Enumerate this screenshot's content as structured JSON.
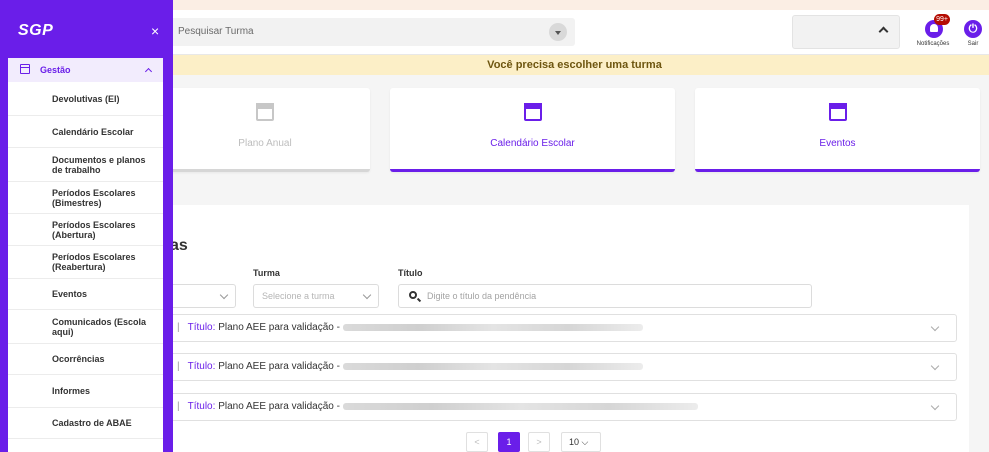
{
  "brand": "SGP",
  "header": {
    "search_placeholder": "Pesquisar Turma",
    "notifications_badge": "99+",
    "notifications_label": "Notificações",
    "logout_label": "Sair"
  },
  "alert": "Você precisa escolher uma turma",
  "cards": [
    {
      "label": "Plano Anual",
      "icon": "calendar-minus-icon",
      "state": "disabled"
    },
    {
      "label": "Calendário Escolar",
      "icon": "calendar-grid-icon",
      "state": "active"
    },
    {
      "label": "Eventos",
      "icon": "calendar-check-icon",
      "state": "active"
    }
  ],
  "panel": {
    "title_fragment": "as",
    "filters": {
      "turma_label": "Turma",
      "turma_placeholder": "Selecione a turma",
      "titulo_label": "Título",
      "titulo_placeholder": "Digite o título da pendência"
    },
    "rows": [
      {
        "separator": "|",
        "key": "Título:",
        "value": "Plano AEE para validação -"
      },
      {
        "separator": "|",
        "key": "Título:",
        "value": "Plano AEE para validação -"
      },
      {
        "separator": "|",
        "key": "Título:",
        "value": "Plano AEE para validação -"
      }
    ],
    "pagination": {
      "prev": "<",
      "current": "1",
      "next": ">",
      "page_size": "10"
    }
  },
  "sidebar": {
    "close": "×",
    "section": "Gestão",
    "items": [
      "Devolutivas (EI)",
      "Calendário Escolar",
      "Documentos e planos de trabalho",
      "Períodos Escolares (Bimestres)",
      "Períodos Escolares (Abertura)",
      "Períodos Escolares (Reabertura)",
      "Eventos",
      "Comunicados (Escola aqui)",
      "Ocorrências",
      "Informes",
      "Cadastro de ABAE"
    ]
  },
  "colors": {
    "accent": "#6a1ee9",
    "alert_bg": "#fcefc7",
    "badge": "#b40c02"
  }
}
